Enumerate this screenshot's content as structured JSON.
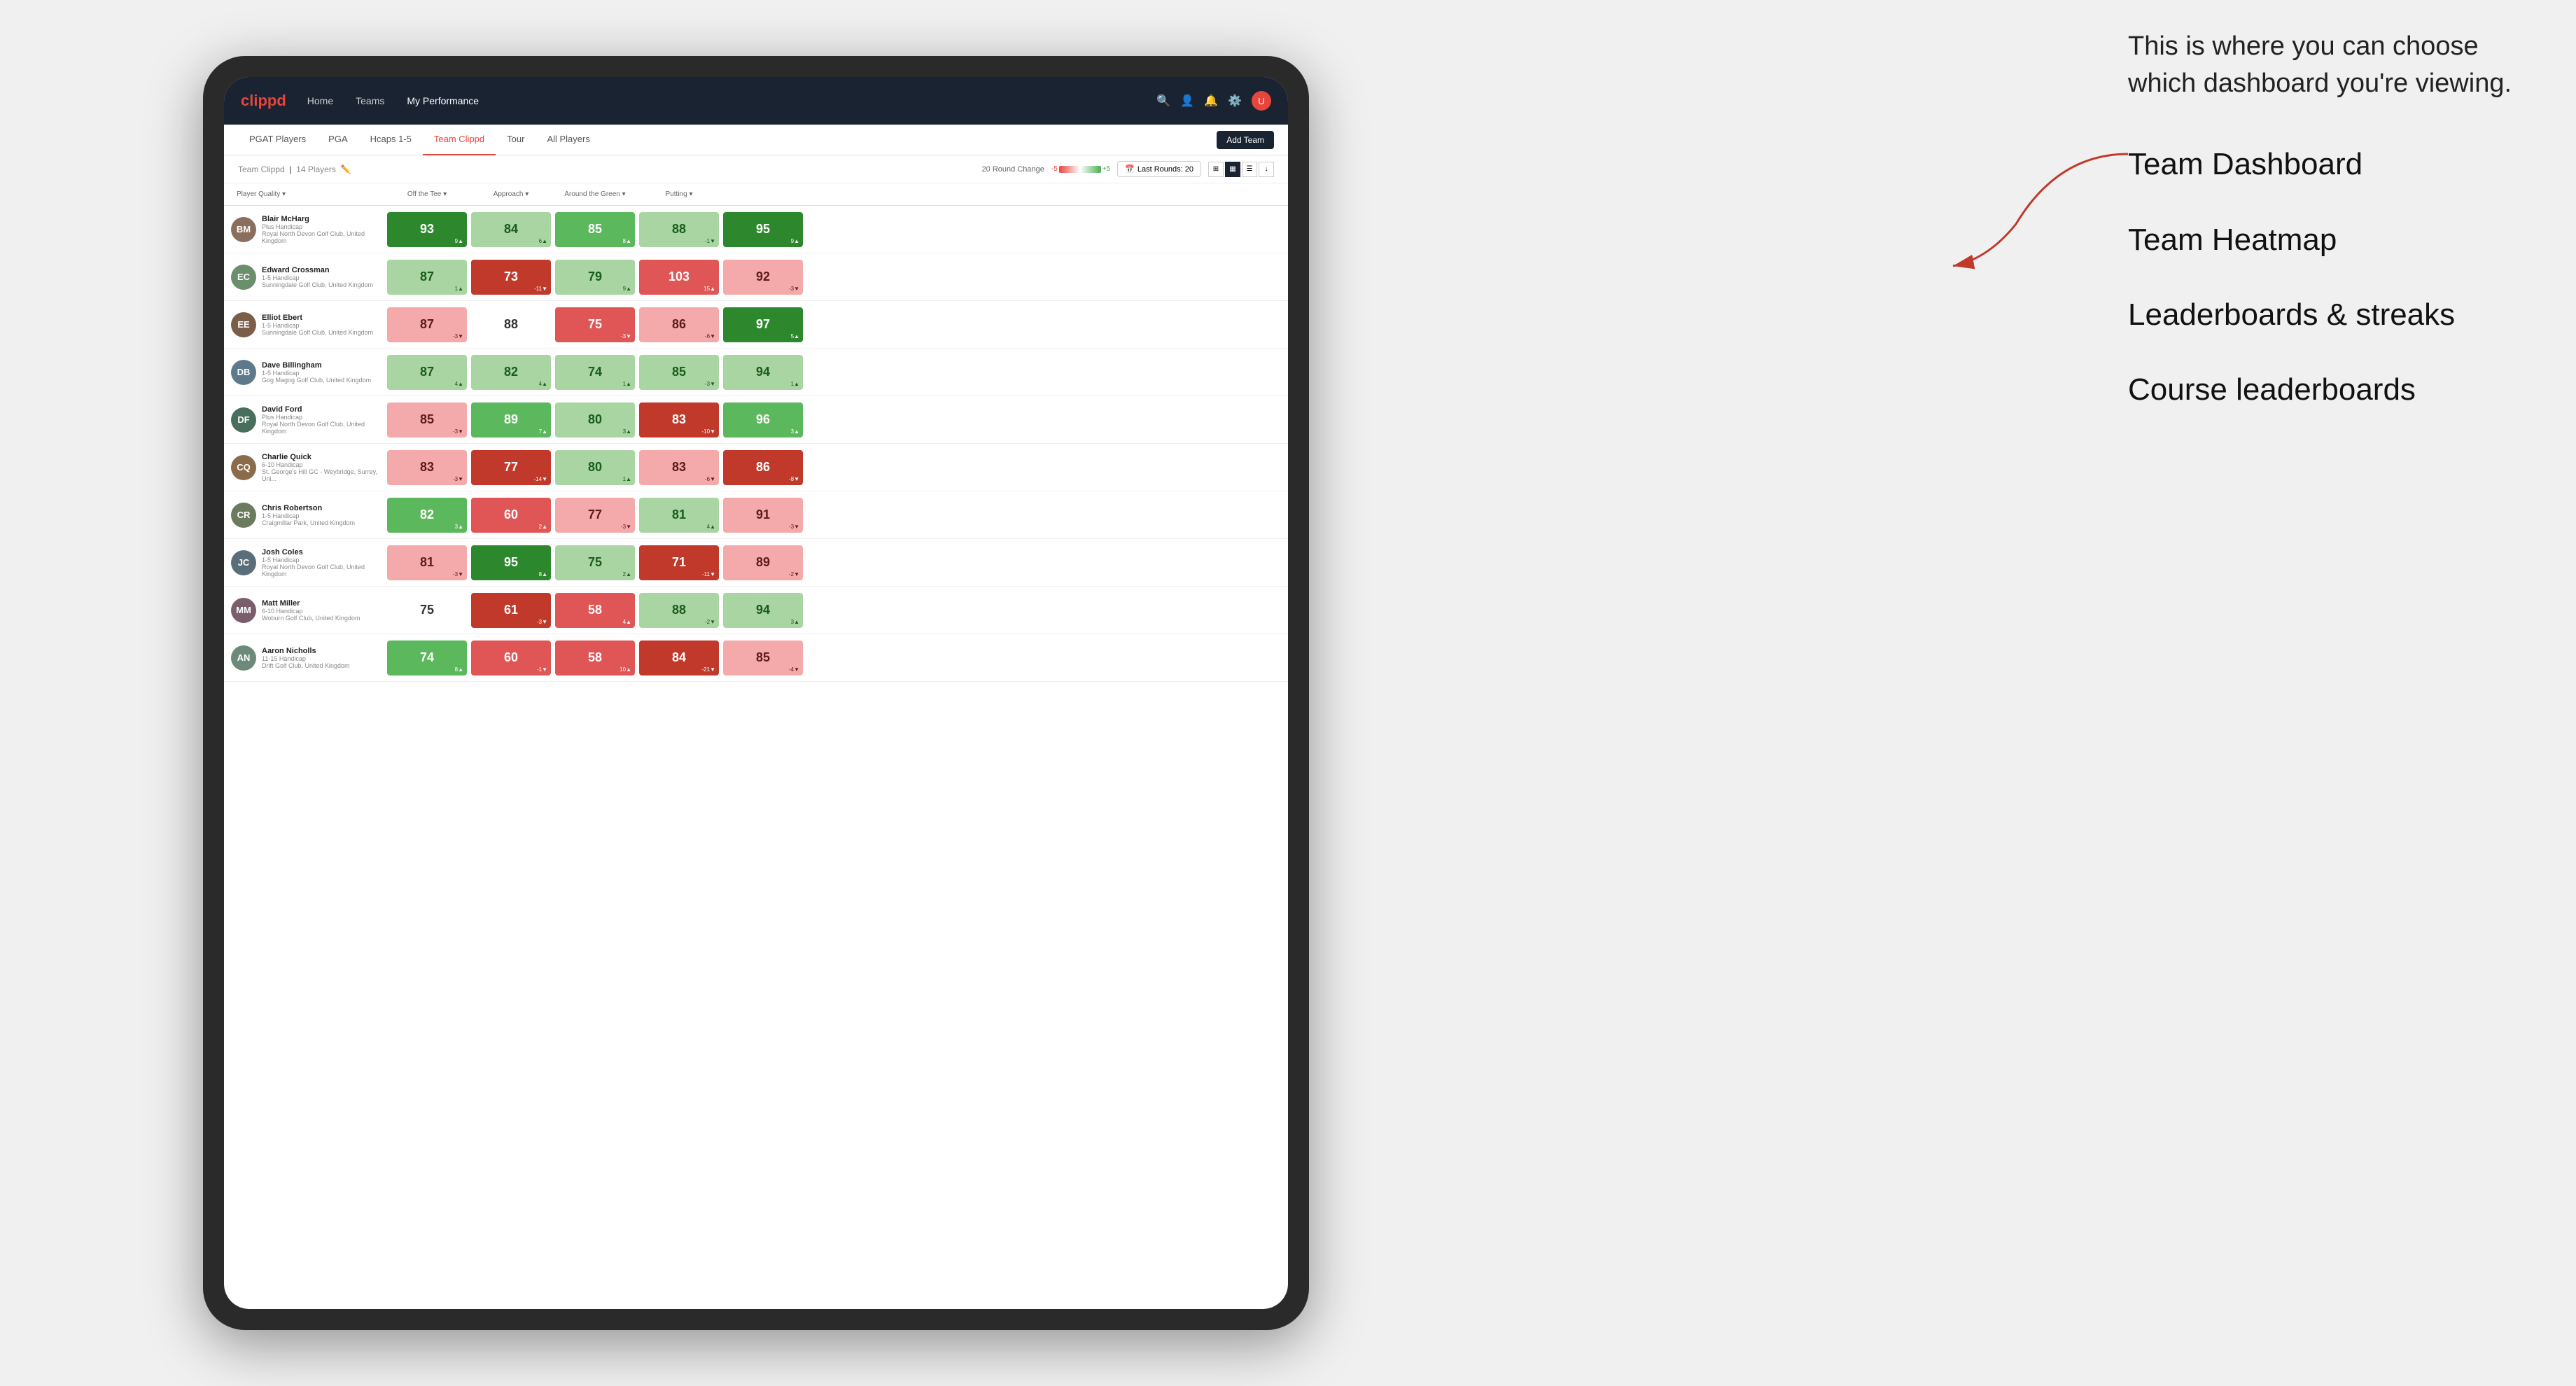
{
  "annotation": {
    "intro": "This is where you can choose which dashboard you're viewing.",
    "items": [
      "Team Dashboard",
      "Team Heatmap",
      "Leaderboards & streaks",
      "Course leaderboards"
    ]
  },
  "navbar": {
    "logo": "clippd",
    "links": [
      "Home",
      "Teams",
      "My Performance"
    ],
    "active_link": "My Performance"
  },
  "tabs": {
    "items": [
      "PGAT Players",
      "PGA",
      "Hcaps 1-5",
      "Team Clippd",
      "Tour",
      "All Players"
    ],
    "active": "Team Clippd",
    "add_team_label": "Add Team"
  },
  "subheader": {
    "team_name": "Team Clippd",
    "player_count": "14 Players",
    "round_change_label": "20 Round Change",
    "scale_neg": "-5",
    "scale_pos": "+5",
    "last_rounds_label": "Last Rounds: 20"
  },
  "columns": [
    {
      "label": "Player Quality ▾",
      "key": "player_quality"
    },
    {
      "label": "Off the Tee ▾",
      "key": "off_tee"
    },
    {
      "label": "Approach ▾",
      "key": "approach"
    },
    {
      "label": "Around the Green ▾",
      "key": "around_green"
    },
    {
      "label": "Putting ▾",
      "key": "putting"
    }
  ],
  "players": [
    {
      "name": "Blair McHarg",
      "handicap": "Plus Handicap",
      "club": "Royal North Devon Golf Club, United Kingdom",
      "initials": "BM",
      "color": "#8B6F5E",
      "scores": [
        {
          "value": "93",
          "change": "9▲",
          "dir": "up",
          "color": "green-dark"
        },
        {
          "value": "84",
          "change": "6▲",
          "dir": "up",
          "color": "green-light"
        },
        {
          "value": "85",
          "change": "8▲",
          "dir": "up",
          "color": "green-mid"
        },
        {
          "value": "88",
          "change": "-1▼",
          "dir": "down",
          "color": "green-light"
        },
        {
          "value": "95",
          "change": "9▲",
          "dir": "up",
          "color": "green-dark"
        }
      ]
    },
    {
      "name": "Edward Crossman",
      "handicap": "1-5 Handicap",
      "club": "Sunningdale Golf Club, United Kingdom",
      "initials": "EC",
      "color": "#6B8E6B",
      "scores": [
        {
          "value": "87",
          "change": "1▲",
          "dir": "up",
          "color": "green-light"
        },
        {
          "value": "73",
          "change": "-11▼",
          "dir": "down",
          "color": "red-dark"
        },
        {
          "value": "79",
          "change": "9▲",
          "dir": "up",
          "color": "green-light"
        },
        {
          "value": "103",
          "change": "15▲",
          "dir": "up",
          "color": "red-mid"
        },
        {
          "value": "92",
          "change": "-3▼",
          "dir": "down",
          "color": "red-light"
        }
      ]
    },
    {
      "name": "Elliot Ebert",
      "handicap": "1-5 Handicap",
      "club": "Sunningdale Golf Club, United Kingdom",
      "initials": "EE",
      "color": "#7B5E4A",
      "scores": [
        {
          "value": "87",
          "change": "-3▼",
          "dir": "down",
          "color": "red-light"
        },
        {
          "value": "88",
          "change": "",
          "dir": "",
          "color": "white"
        },
        {
          "value": "75",
          "change": "-3▼",
          "dir": "down",
          "color": "red-mid"
        },
        {
          "value": "86",
          "change": "-6▼",
          "dir": "down",
          "color": "red-light"
        },
        {
          "value": "97",
          "change": "5▲",
          "dir": "up",
          "color": "green-dark"
        }
      ]
    },
    {
      "name": "Dave Billingham",
      "handicap": "1-5 Handicap",
      "club": "Gog Magog Golf Club, United Kingdom",
      "initials": "DB",
      "color": "#5E7A8A",
      "scores": [
        {
          "value": "87",
          "change": "4▲",
          "dir": "up",
          "color": "green-light"
        },
        {
          "value": "82",
          "change": "4▲",
          "dir": "up",
          "color": "green-light"
        },
        {
          "value": "74",
          "change": "1▲",
          "dir": "up",
          "color": "green-light"
        },
        {
          "value": "85",
          "change": "-3▼",
          "dir": "down",
          "color": "green-light"
        },
        {
          "value": "94",
          "change": "1▲",
          "dir": "up",
          "color": "green-light"
        }
      ]
    },
    {
      "name": "David Ford",
      "handicap": "Plus Handicap",
      "club": "Royal North Devon Golf Club, United Kingdom",
      "initials": "DF",
      "color": "#4A6E5E",
      "scores": [
        {
          "value": "85",
          "change": "-3▼",
          "dir": "down",
          "color": "red-light"
        },
        {
          "value": "89",
          "change": "7▲",
          "dir": "up",
          "color": "green-mid"
        },
        {
          "value": "80",
          "change": "3▲",
          "dir": "up",
          "color": "green-light"
        },
        {
          "value": "83",
          "change": "-10▼",
          "dir": "down",
          "color": "red-dark"
        },
        {
          "value": "96",
          "change": "3▲",
          "dir": "up",
          "color": "green-mid"
        }
      ]
    },
    {
      "name": "Charlie Quick",
      "handicap": "6-10 Handicap",
      "club": "St. George's Hill GC - Weybridge, Surrey, Uni...",
      "initials": "CQ",
      "color": "#8A6B4A",
      "scores": [
        {
          "value": "83",
          "change": "-3▼",
          "dir": "down",
          "color": "red-light"
        },
        {
          "value": "77",
          "change": "-14▼",
          "dir": "down",
          "color": "red-dark"
        },
        {
          "value": "80",
          "change": "1▲",
          "dir": "up",
          "color": "green-light"
        },
        {
          "value": "83",
          "change": "-6▼",
          "dir": "down",
          "color": "red-light"
        },
        {
          "value": "86",
          "change": "-8▼",
          "dir": "down",
          "color": "red-dark"
        }
      ]
    },
    {
      "name": "Chris Robertson",
      "handicap": "1-5 Handicap",
      "club": "Craigmillar Park, United Kingdom",
      "initials": "CR",
      "color": "#6B7B5E",
      "scores": [
        {
          "value": "82",
          "change": "3▲",
          "dir": "up",
          "color": "green-mid"
        },
        {
          "value": "60",
          "change": "2▲",
          "dir": "up",
          "color": "red-mid"
        },
        {
          "value": "77",
          "change": "-3▼",
          "dir": "down",
          "color": "red-light"
        },
        {
          "value": "81",
          "change": "4▲",
          "dir": "up",
          "color": "green-light"
        },
        {
          "value": "91",
          "change": "-3▼",
          "dir": "down",
          "color": "red-light"
        }
      ]
    },
    {
      "name": "Josh Coles",
      "handicap": "1-5 Handicap",
      "club": "Royal North Devon Golf Club, United Kingdom",
      "initials": "JC",
      "color": "#5A6E7A",
      "scores": [
        {
          "value": "81",
          "change": "-3▼",
          "dir": "down",
          "color": "red-light"
        },
        {
          "value": "95",
          "change": "8▲",
          "dir": "up",
          "color": "green-dark"
        },
        {
          "value": "75",
          "change": "2▲",
          "dir": "up",
          "color": "green-light"
        },
        {
          "value": "71",
          "change": "-11▼",
          "dir": "down",
          "color": "red-dark"
        },
        {
          "value": "89",
          "change": "-2▼",
          "dir": "down",
          "color": "red-light"
        }
      ]
    },
    {
      "name": "Matt Miller",
      "handicap": "6-10 Handicap",
      "club": "Woburn Golf Club, United Kingdom",
      "initials": "MM",
      "color": "#7A5E6B",
      "scores": [
        {
          "value": "75",
          "change": "",
          "dir": "",
          "color": "white"
        },
        {
          "value": "61",
          "change": "-3▼",
          "dir": "down",
          "color": "red-dark"
        },
        {
          "value": "58",
          "change": "4▲",
          "dir": "up",
          "color": "red-mid"
        },
        {
          "value": "88",
          "change": "-2▼",
          "dir": "down",
          "color": "green-light"
        },
        {
          "value": "94",
          "change": "3▲",
          "dir": "up",
          "color": "green-light"
        }
      ]
    },
    {
      "name": "Aaron Nicholls",
      "handicap": "11-15 Handicap",
      "club": "Drift Golf Club, United Kingdom",
      "initials": "AN",
      "color": "#6B8A7A",
      "scores": [
        {
          "value": "74",
          "change": "8▲",
          "dir": "up",
          "color": "green-mid"
        },
        {
          "value": "60",
          "change": "-1▼",
          "dir": "down",
          "color": "red-mid"
        },
        {
          "value": "58",
          "change": "10▲",
          "dir": "up",
          "color": "red-mid"
        },
        {
          "value": "84",
          "change": "-21▼",
          "dir": "down",
          "color": "red-dark"
        },
        {
          "value": "85",
          "change": "-4▼",
          "dir": "down",
          "color": "red-light"
        }
      ]
    }
  ]
}
